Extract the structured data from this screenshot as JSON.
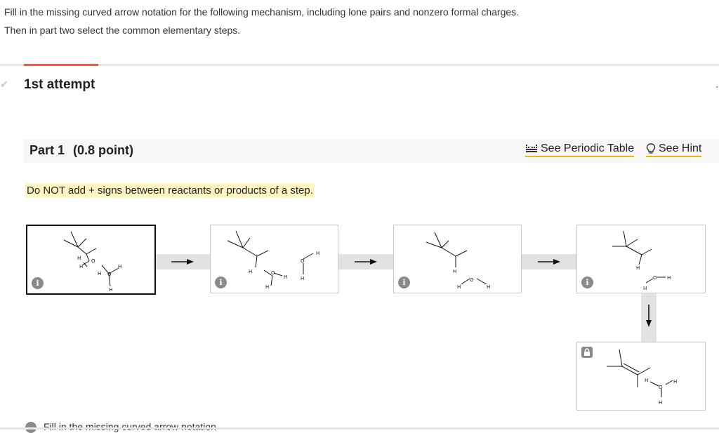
{
  "question": {
    "line1": "Fill in the missing curved arrow notation for the following mechanism, including lone pairs and nonzero formal charges.",
    "line2": "Then in part two select the common elementary steps."
  },
  "attempt": {
    "label": "1st attempt"
  },
  "part": {
    "title": "Part 1",
    "points": "(0.8 point)"
  },
  "tools": {
    "periodic_table": "See Periodic Table",
    "hint": "See Hint"
  },
  "note": "Do NOT add + signs between reactants or products of a step.",
  "info_symbol": "i",
  "panels": {
    "p1": {
      "H": "H",
      "O": "O",
      "O2": "O"
    },
    "atom_H": "H",
    "atom_O": "O"
  },
  "bottom": {
    "text": "Fill in the missing curved arrow notation"
  },
  "colors": {
    "accent": "#f15a3a",
    "underline": "#f2b705",
    "highlight": "#fdf6c3"
  }
}
